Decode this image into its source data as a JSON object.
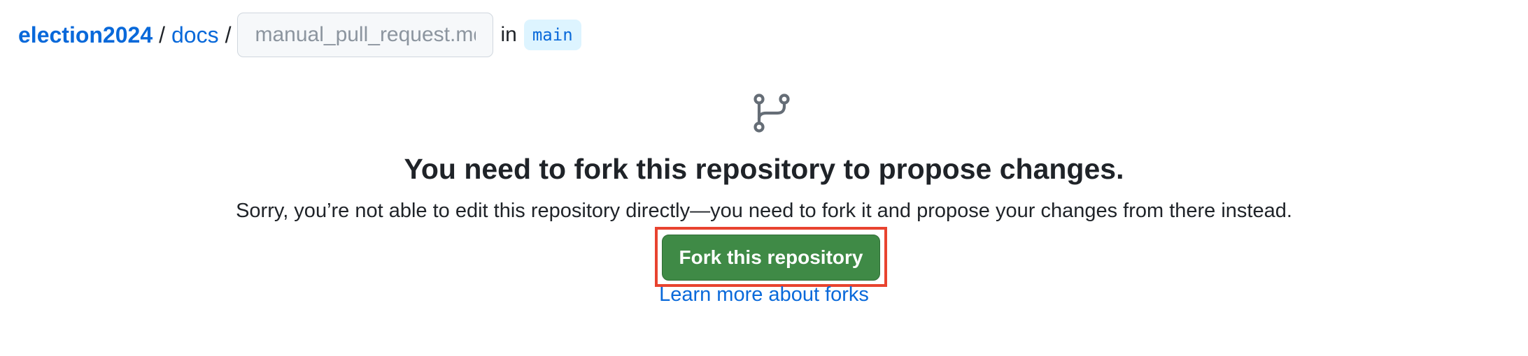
{
  "breadcrumb": {
    "repo": "election2024",
    "separator": "/",
    "directory": "docs",
    "filename_placeholder": "manual_pull_request.md",
    "in_label": "in",
    "branch": "main"
  },
  "icons": {
    "fork": "git-fork-icon"
  },
  "main": {
    "heading": "You need to fork this repository to propose changes.",
    "description": "Sorry, you’re not able to edit this repository directly—you need to fork it and propose your changes from there instead.",
    "fork_button_label": "Fork this repository",
    "learn_more_link": "Learn more about forks"
  },
  "colors": {
    "link": "#0969da",
    "button_green": "#3f8a46",
    "highlight_red": "#e8432f",
    "branch_bg": "#ddf4ff"
  }
}
